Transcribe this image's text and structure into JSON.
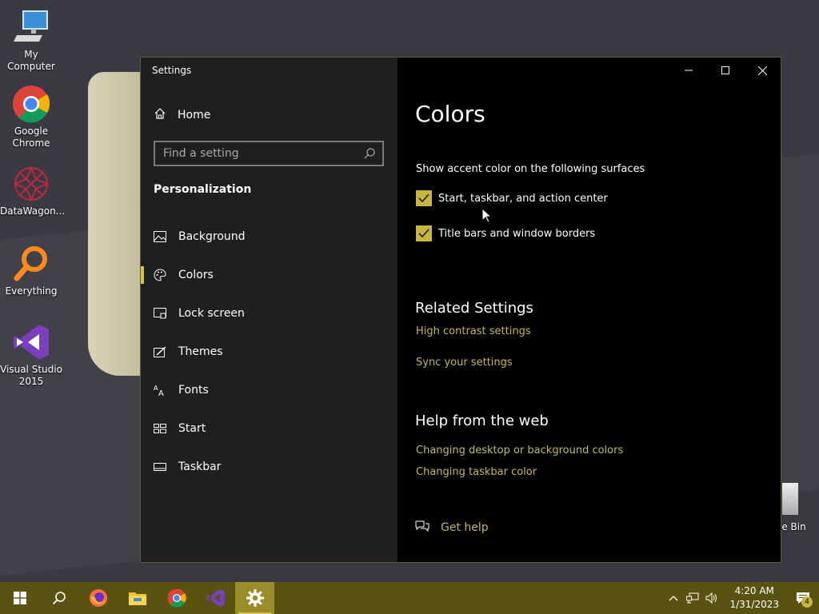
{
  "desktop": {
    "icons": [
      {
        "label": "My Computer",
        "icon": "computer-icon"
      },
      {
        "label": "Google Chrome",
        "icon": "chrome-icon"
      },
      {
        "label": "DataWagon...",
        "icon": "datawagon-icon"
      },
      {
        "label": "Everything",
        "icon": "everything-search-icon"
      },
      {
        "label": "Visual Studio 2015",
        "icon": "visual-studio-icon"
      }
    ],
    "recycle_bin_label": "le Bin"
  },
  "window": {
    "title": "Settings",
    "accent": "#c7b63b",
    "link_color": "#c8b75a"
  },
  "sidebar": {
    "home_label": "Home",
    "search_placeholder": "Find a setting",
    "section_title": "Personalization",
    "items": [
      {
        "label": "Background",
        "icon": "picture-icon",
        "active": false
      },
      {
        "label": "Colors",
        "icon": "palette-icon",
        "active": true
      },
      {
        "label": "Lock screen",
        "icon": "lock-screen-icon",
        "active": false
      },
      {
        "label": "Themes",
        "icon": "themes-icon",
        "active": false
      },
      {
        "label": "Fonts",
        "icon": "fonts-icon",
        "active": false
      },
      {
        "label": "Start",
        "icon": "start-layout-icon",
        "active": false
      },
      {
        "label": "Taskbar",
        "icon": "taskbar-icon",
        "active": false
      }
    ]
  },
  "main": {
    "title": "Colors",
    "accent_surfaces_label": "Show accent color on the following surfaces",
    "checkboxes": [
      {
        "label": "Start, taskbar, and action center",
        "checked": true
      },
      {
        "label": "Title bars and window borders",
        "checked": true
      }
    ],
    "related": {
      "title": "Related Settings",
      "links": [
        "High contrast settings",
        "Sync your settings"
      ]
    },
    "help": {
      "title": "Help from the web",
      "links": [
        "Changing desktop or background colors",
        "Changing taskbar color"
      ]
    },
    "get_help_label": "Get help"
  },
  "taskbar": {
    "apps": [
      "start-icon",
      "search-icon",
      "firefox-icon",
      "file-explorer-icon",
      "chrome-icon",
      "visual-studio-icon",
      "settings-gear-icon"
    ],
    "time": "4:20 AM",
    "date": "1/31/2023",
    "notification_count": "4"
  }
}
